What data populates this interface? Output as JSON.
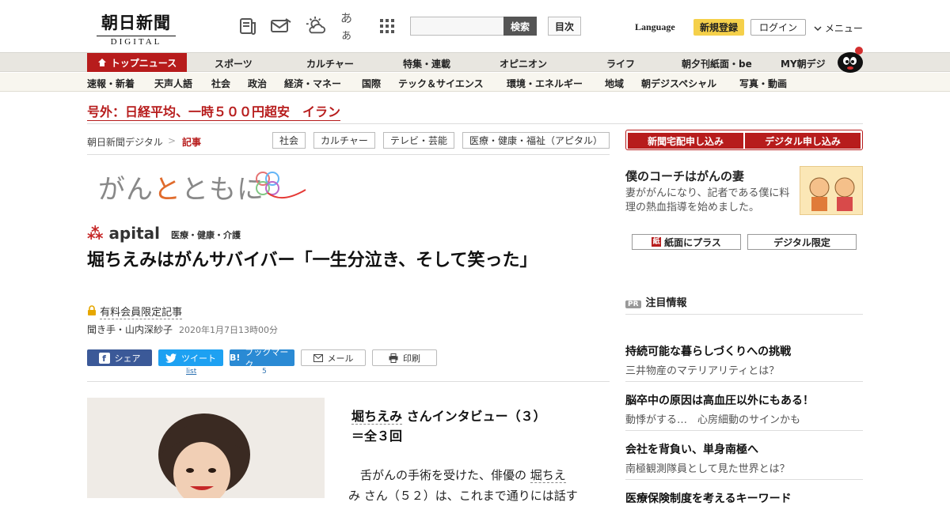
{
  "header": {
    "logo_main": "朝日新聞",
    "logo_sub": "DIGITAL",
    "icons": [
      "newspaper-icon",
      "mail-icon",
      "weather-icon",
      "font-size-icon",
      "grid-icon"
    ],
    "font_icon_text": "あぁ",
    "search_placeholder": "",
    "search_button": "検索",
    "index_button": "目次",
    "language": "Language",
    "signup": "新規登録",
    "login": "ログイン",
    "menu": "メニュー"
  },
  "nav_primary": [
    {
      "label": "トップニュース",
      "active": true
    },
    {
      "label": "スポーツ"
    },
    {
      "label": "カルチャー"
    },
    {
      "label": "特集・連載"
    },
    {
      "label": "オピニオン"
    },
    {
      "label": "ライフ"
    },
    {
      "label": "朝夕刊紙面・be"
    },
    {
      "label": "MY朝デジ"
    }
  ],
  "nav_secondary": [
    "速報・新着",
    "天声人語",
    "社会",
    "政治",
    "経済・マネー",
    "国際",
    "テック＆サイエンス",
    "環境・エネルギー",
    "地域",
    "朝デジスペシャル",
    "写真・動画"
  ],
  "breaking": "号外：日経平均、一時５００円超安　イラン",
  "breadcrumb": {
    "home": "朝日新聞デジタル",
    "sep": ">",
    "current": "記事"
  },
  "tags": [
    "社会",
    "カルチャー",
    "テレビ・芸能",
    "医療・健康・福祉（アピタル）"
  ],
  "series": {
    "part1": "がん",
    "part2": "と",
    "part3": "ともに"
  },
  "apital": {
    "logo": "apital",
    "sub": "医療・健康・介護"
  },
  "article": {
    "title": "堀ちえみはがんサバイバー「一生分泣き、そして笑った」",
    "paid_label": "有料会員限定記事",
    "author": "聞き手・山内深紗子",
    "date": "2020年1月7日13時00分",
    "interview_name": "堀ちえみ",
    "interview_rest": " さんインタビュー（３）",
    "interview_line2": "＝全３回",
    "body_pre": "　舌がんの手術を受けた、俳優の ",
    "body_name": "堀ちえ",
    "body_line2": "み さん（５２）は、これまで通りには話す"
  },
  "share": [
    {
      "label": "シェア",
      "icon": "facebook-icon",
      "color": "#3b5998"
    },
    {
      "label": "ツイート",
      "icon": "twitter-icon",
      "color": "#1da1f2",
      "count": "list"
    },
    {
      "label": "ブックマーク",
      "icon": "hatena-icon",
      "color": "#2a8ad4",
      "count": "5"
    },
    {
      "label": "メール",
      "icon": "mail-icon"
    },
    {
      "label": "印刷",
      "icon": "print-icon"
    }
  ],
  "sidebar": {
    "subscribe_paper": "新聞宅配申し込み",
    "subscribe_digital": "デジタル申し込み",
    "feature_title": "僕のコーチはがんの妻",
    "feature_desc": "妻ががんになり、記者である僕に料理の熱血指導を始めました。",
    "plus_label": "紙面にプラス",
    "digital_only": "デジタル限定",
    "pr_badge": "PR",
    "pr_heading": "注目情報",
    "ads": [
      {
        "title": "持続可能な暮らしづくりへの挑戦",
        "desc": "三井物産のマテリアリティとは？"
      },
      {
        "title": "脳卒中の原因は高血圧以外にもある！",
        "desc": "動悸がする…　心房細動のサインかも"
      },
      {
        "title": "会社を背負い、単身南極へ",
        "desc": "南極観測隊員として見た世界とは？"
      },
      {
        "title": "医療保険制度を考えるキーワード",
        "desc": ""
      }
    ]
  }
}
